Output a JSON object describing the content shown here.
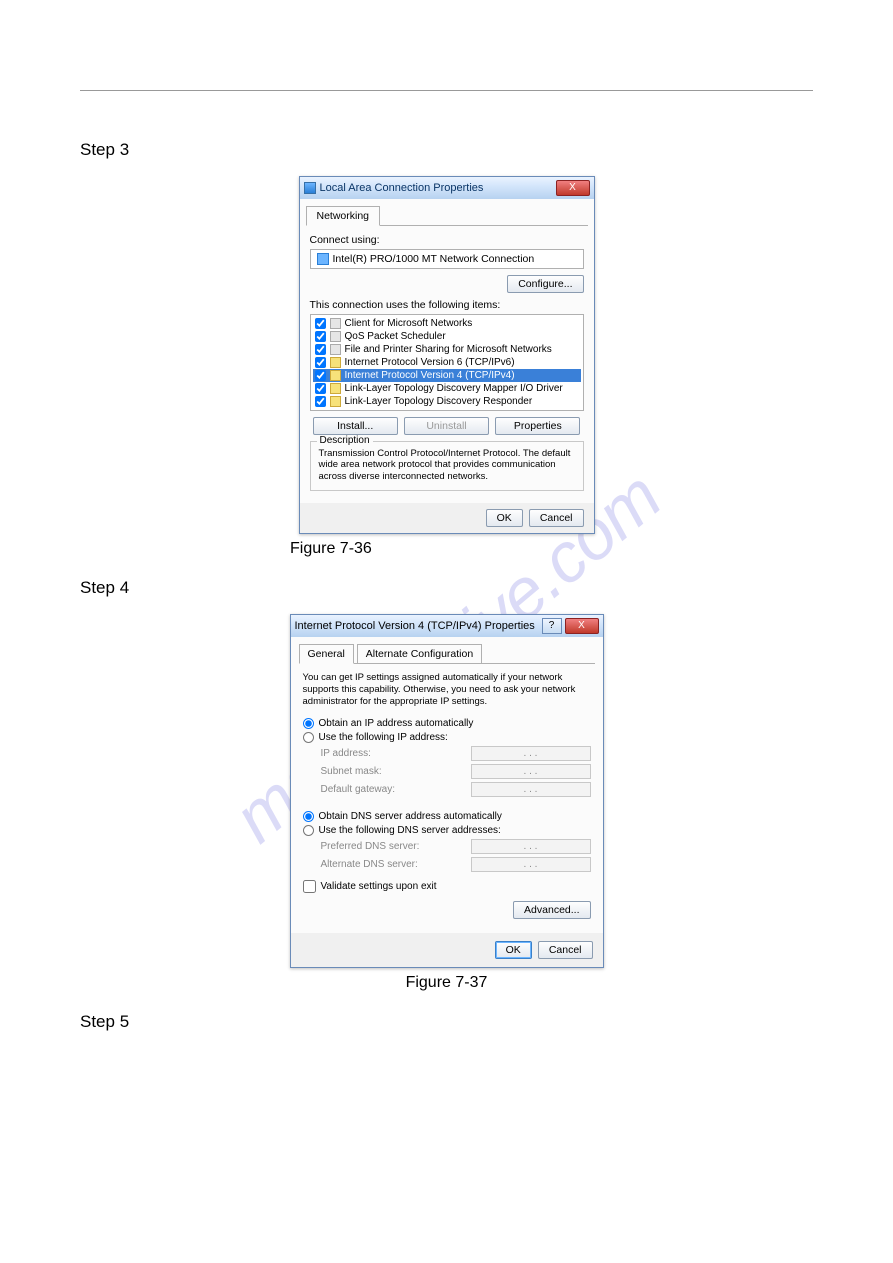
{
  "watermark": "manualshive.com",
  "steps": {
    "s3": "Step 3",
    "s4": "Step 4",
    "s5": "Step 5"
  },
  "figures": {
    "f1": "Figure 7-36",
    "f2": "Figure 7-37"
  },
  "dlg1": {
    "title": "Local Area Connection Properties",
    "close": "X",
    "tab_networking": "Networking",
    "connect_using": "Connect using:",
    "adapter": "Intel(R) PRO/1000 MT Network Connection",
    "btn_configure": "Configure...",
    "items_label": "This connection uses the following items:",
    "items": [
      "Client for Microsoft Networks",
      "QoS Packet Scheduler",
      "File and Printer Sharing for Microsoft Networks",
      "Internet Protocol Version 6 (TCP/IPv6)",
      "Internet Protocol Version 4 (TCP/IPv4)",
      "Link-Layer Topology Discovery Mapper I/O Driver",
      "Link-Layer Topology Discovery Responder"
    ],
    "btn_install": "Install...",
    "btn_uninstall": "Uninstall",
    "btn_properties": "Properties",
    "desc_legend": "Description",
    "desc_text": "Transmission Control Protocol/Internet Protocol. The default wide area network protocol that provides communication across diverse interconnected networks.",
    "btn_ok": "OK",
    "btn_cancel": "Cancel"
  },
  "dlg2": {
    "title": "Internet Protocol Version 4 (TCP/IPv4) Properties",
    "help": "?",
    "close": "X",
    "tab_general": "General",
    "tab_alt": "Alternate Configuration",
    "intro": "You can get IP settings assigned automatically if your network supports this capability. Otherwise, you need to ask your network administrator for the appropriate IP settings.",
    "r_auto_ip": "Obtain an IP address automatically",
    "r_use_ip": "Use the following IP address:",
    "f_ip": "IP address:",
    "f_mask": "Subnet mask:",
    "f_gw": "Default gateway:",
    "ip_placeholder": ".       .       .",
    "r_auto_dns": "Obtain DNS server address automatically",
    "r_use_dns": "Use the following DNS server addresses:",
    "f_dns1": "Preferred DNS server:",
    "f_dns2": "Alternate DNS server:",
    "chk_validate": "Validate settings upon exit",
    "btn_advanced": "Advanced...",
    "btn_ok": "OK",
    "btn_cancel": "Cancel"
  }
}
